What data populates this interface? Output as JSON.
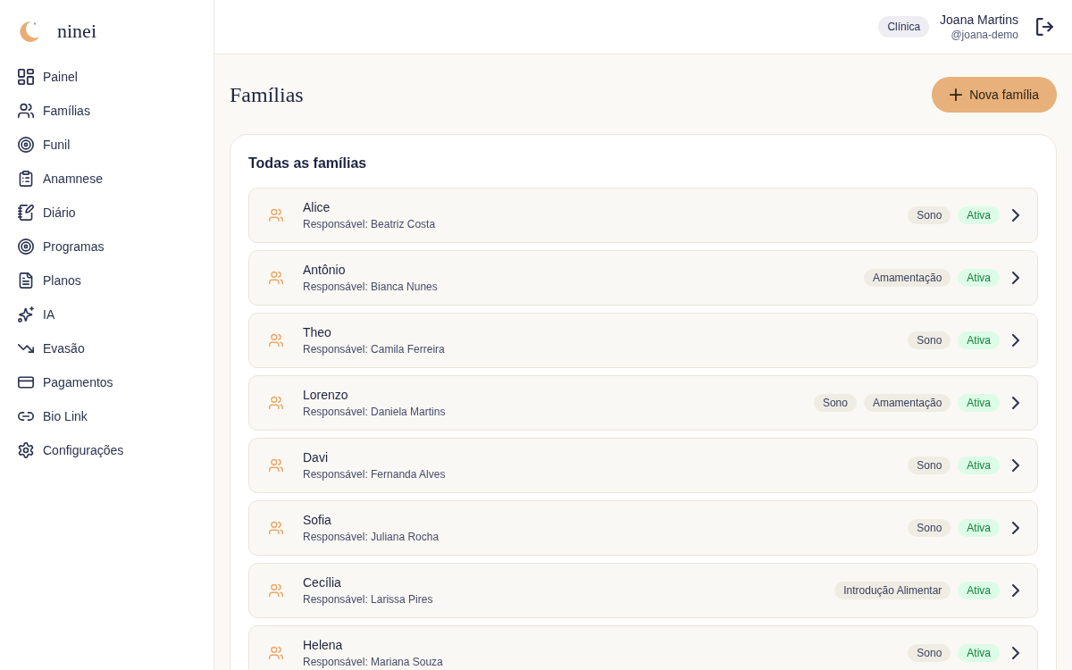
{
  "logo": {
    "text": "ninei"
  },
  "sidebar": {
    "items": [
      {
        "label": "Painel"
      },
      {
        "label": "Famílias"
      },
      {
        "label": "Funil"
      },
      {
        "label": "Anamnese"
      },
      {
        "label": "Diário"
      },
      {
        "label": "Programas"
      },
      {
        "label": "Planos"
      },
      {
        "label": "IA"
      },
      {
        "label": "Evasão"
      },
      {
        "label": "Pagamentos"
      },
      {
        "label": "Bio Link"
      },
      {
        "label": "Configurações"
      }
    ]
  },
  "header": {
    "role_badge": "Clínica",
    "user": {
      "name": "Joana Martins",
      "handle": "@joana-demo"
    }
  },
  "page": {
    "title": "Famílias",
    "new_button": "Nova família"
  },
  "families": {
    "title": "Todas as famílias",
    "rows": [
      {
        "name": "Alice",
        "guardian": "Responsável: Beatriz Costa",
        "tags": [
          "Sono"
        ],
        "status": "Ativa"
      },
      {
        "name": "Antônio",
        "guardian": "Responsável: Bianca Nunes",
        "tags": [
          "Amamentação"
        ],
        "status": "Ativa"
      },
      {
        "name": "Theo",
        "guardian": "Responsável: Camila Ferreira",
        "tags": [
          "Sono"
        ],
        "status": "Ativa"
      },
      {
        "name": "Lorenzo",
        "guardian": "Responsável: Daniela Martins",
        "tags": [
          "Sono",
          "Amamentação"
        ],
        "status": "Ativa"
      },
      {
        "name": "Davi",
        "guardian": "Responsável: Fernanda Alves",
        "tags": [
          "Sono"
        ],
        "status": "Ativa"
      },
      {
        "name": "Sofia",
        "guardian": "Responsável: Juliana Rocha",
        "tags": [
          "Sono"
        ],
        "status": "Ativa"
      },
      {
        "name": "Cecília",
        "guardian": "Responsável: Larissa Pires",
        "tags": [
          "Introdução Alimentar"
        ],
        "status": "Ativa"
      },
      {
        "name": "Helena",
        "guardian": "Responsável: Mariana Souza",
        "tags": [
          "Sono"
        ],
        "status": "Ativa"
      }
    ]
  }
}
